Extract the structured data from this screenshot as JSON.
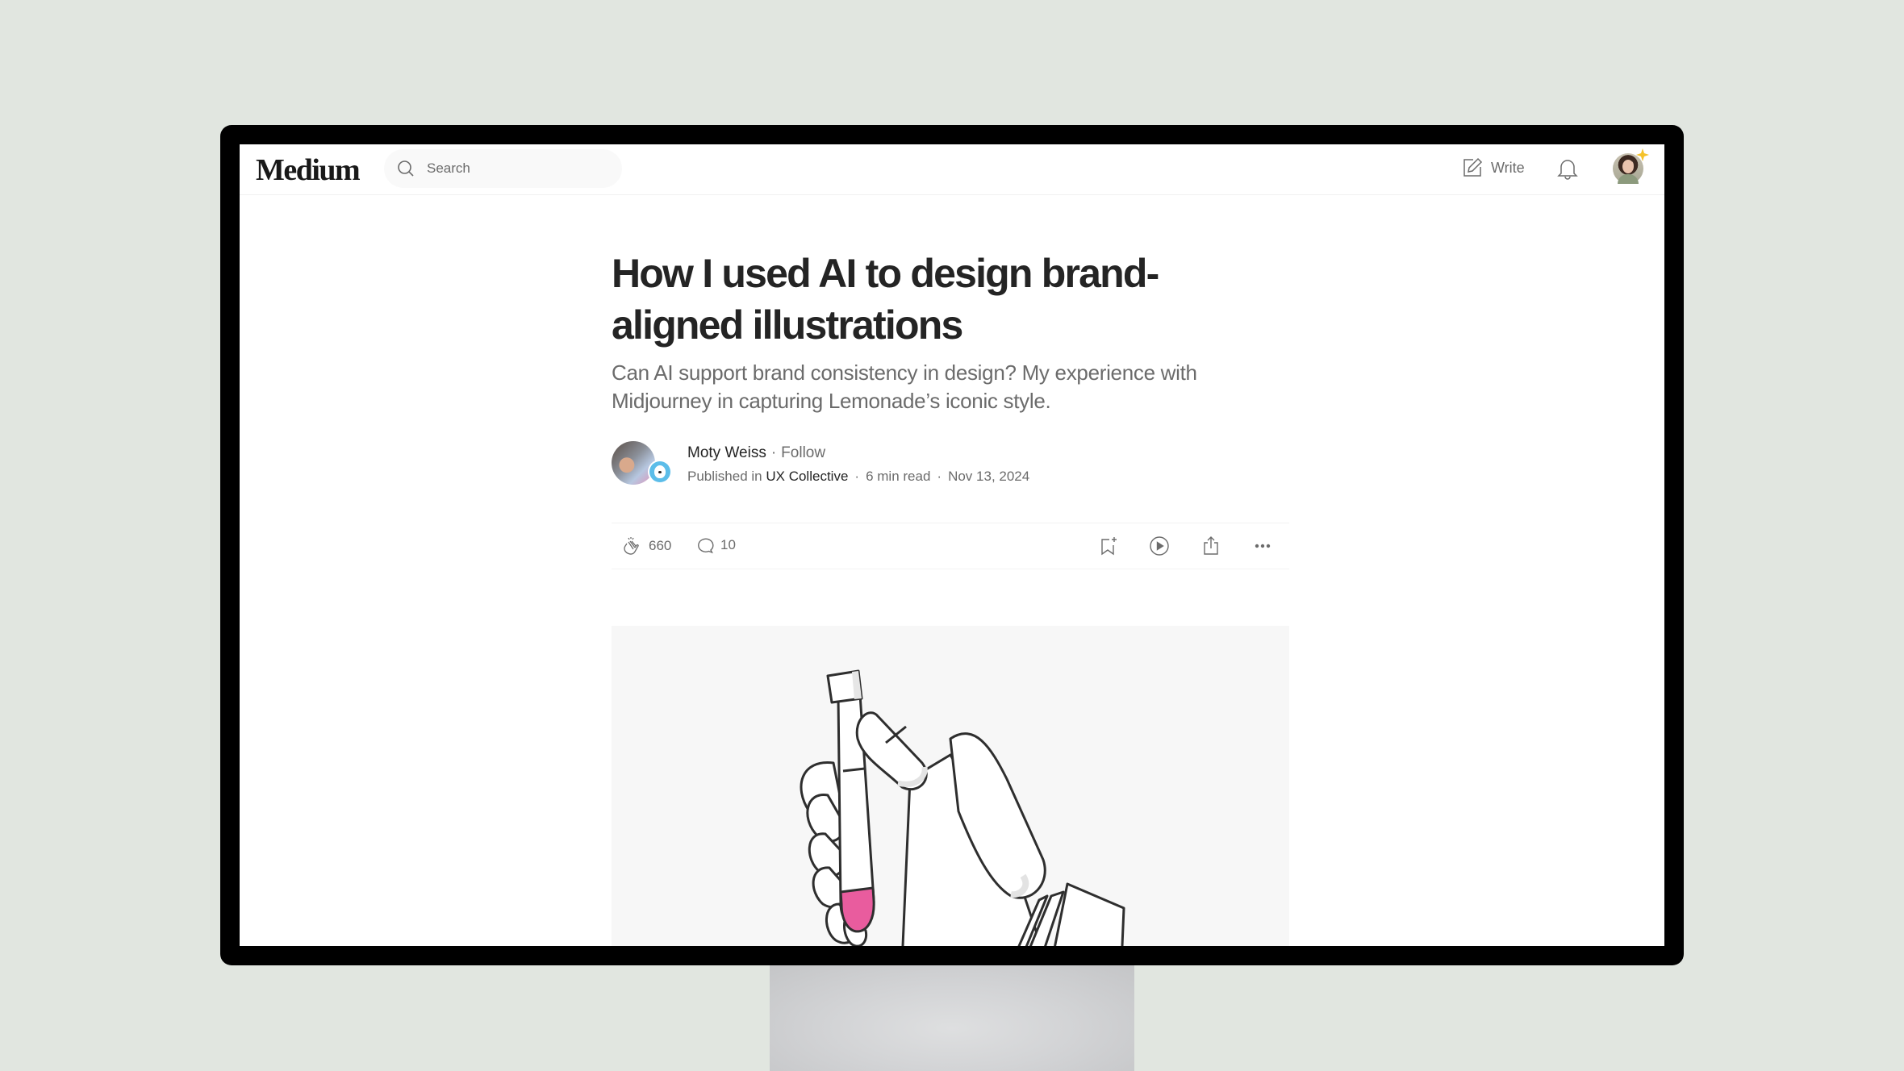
{
  "header": {
    "logo": "Medium",
    "search_placeholder": "Search",
    "write_label": "Write",
    "icons": {
      "search": "search-icon",
      "write": "pencil-square-icon",
      "notifications": "bell-icon",
      "avatar": "user-avatar",
      "membership": "sparkle-star-icon"
    }
  },
  "article": {
    "title": "How I used AI to design brand-aligned illustrations",
    "subtitle": "Can AI support brand consistency in design? My experience with Midjourney in capturing Lemonade’s iconic style.",
    "author": {
      "name": "Moty Weiss",
      "separator": "·",
      "follow_label": "Follow"
    },
    "meta": {
      "published_prefix": "Published in",
      "publication": "UX Collective",
      "read_time": "6 min read",
      "date": "Nov 13, 2024",
      "separator": "·"
    },
    "actions": {
      "claps": "660",
      "comments": "10",
      "icons": [
        "clap-icon",
        "comment-icon",
        "bookmark-add-icon",
        "play-icon",
        "share-icon",
        "more-icon"
      ]
    },
    "hero_image": {
      "alt": "Illustration of a robotic hand holding a test tube with pink liquid",
      "accent_color": "#e95c9e"
    }
  },
  "colors": {
    "background": "#e1e6e0",
    "text_primary": "#242424",
    "text_secondary": "#6b6b6b",
    "star": "#f5c22a"
  }
}
